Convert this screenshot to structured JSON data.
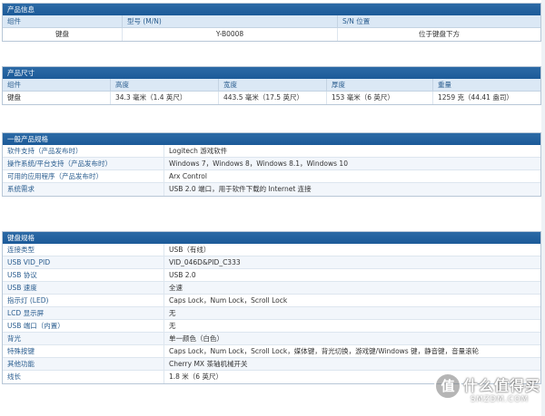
{
  "product_info": {
    "title": "产品信息",
    "headers": [
      "组件",
      "型号 (M/N)",
      "S/N 位置"
    ],
    "rows": [
      [
        "键盘",
        "Y-B0008",
        "位于键盘下方"
      ]
    ]
  },
  "product_dims": {
    "title": "产品尺寸",
    "headers": [
      "组件",
      "高度",
      "宽度",
      "厚度",
      "重量"
    ],
    "rows": [
      [
        "键盘",
        "34.3 毫米（1.4 英尺）",
        "443.5 毫米（17.5 英尺）",
        "153 毫米（6 英尺）",
        "1259 克（44.41 盎司）"
      ]
    ]
  },
  "general_specs": {
    "title": "一般产品规格",
    "rows": [
      [
        "软件支持（产品发布时）",
        "Logitech 游戏软件"
      ],
      [
        "操作系统/平台支持（产品发布时）",
        "Windows 7，Windows 8，Windows 8.1，Windows 10"
      ],
      [
        "可用的应用程序（产品发布时）",
        "Arx Control"
      ],
      [
        "系统需求",
        "USB 2.0 端口，用于软件下载的 Internet 连接"
      ]
    ]
  },
  "keyboard_specs": {
    "title": "键盘规格",
    "rows": [
      [
        "连接类型",
        "USB（有线）"
      ],
      [
        "USB VID_PID",
        "VID_046D&PID_C333"
      ],
      [
        "USB 协议",
        "USB 2.0"
      ],
      [
        "USB 速度",
        "全速"
      ],
      [
        "指示灯 (LED)",
        "Caps Lock，Num Lock，Scroll Lock"
      ],
      [
        "LCD 显示屏",
        "无"
      ],
      [
        "USB 端口（内置）",
        "无"
      ],
      [
        "背光",
        "单一颜色（白色）"
      ],
      [
        "特殊按键",
        "Caps Lock，Num Lock，Scroll Lock，媒体键，背光切换，游戏键/Windows 键，静音键，音量滚轮"
      ],
      [
        "其他功能",
        "Cherry MX 茶轴机械开关"
      ],
      [
        "线长",
        "1.8 米（6 英尺）"
      ]
    ]
  },
  "watermark": {
    "badge": "值",
    "title": "什么值得买",
    "sub": "SMZDM.COM"
  }
}
